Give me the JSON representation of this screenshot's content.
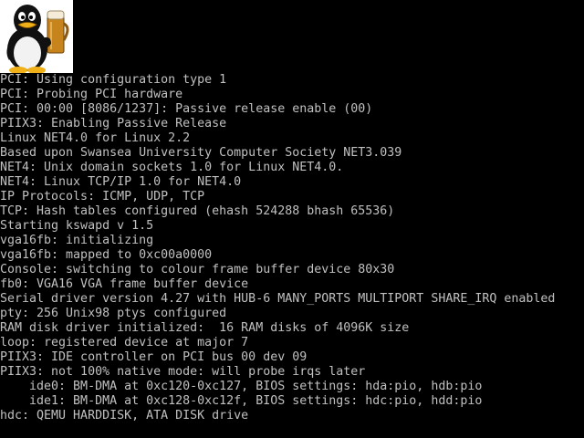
{
  "screen": {
    "background": "#000000",
    "text_color": "#c0c0c0"
  },
  "logo": {
    "icon": "tux-penguin-with-beer-icon"
  },
  "console": {
    "lines": [
      "PCI: Using configuration type 1",
      "PCI: Probing PCI hardware",
      "PCI: 00:00 [8086/1237]: Passive release enable (00)",
      "PIIX3: Enabling Passive Release",
      "Linux NET4.0 for Linux 2.2",
      "Based upon Swansea University Computer Society NET3.039",
      "NET4: Unix domain sockets 1.0 for Linux NET4.0.",
      "NET4: Linux TCP/IP 1.0 for NET4.0",
      "IP Protocols: ICMP, UDP, TCP",
      "TCP: Hash tables configured (ehash 524288 bhash 65536)",
      "Starting kswapd v 1.5",
      "vga16fb: initializing",
      "vga16fb: mapped to 0xc00a0000",
      "Console: switching to colour frame buffer device 80x30",
      "fb0: VGA16 VGA frame buffer device",
      "Serial driver version 4.27 with HUB-6 MANY_PORTS MULTIPORT SHARE_IRQ enabled",
      "pty: 256 Unix98 ptys configured",
      "RAM disk driver initialized:  16 RAM disks of 4096K size",
      "loop: registered device at major 7",
      "PIIX3: IDE controller on PCI bus 00 dev 09",
      "PIIX3: not 100% native mode: will probe irqs later",
      "    ide0: BM-DMA at 0xc120-0xc127, BIOS settings: hda:pio, hdb:pio",
      "    ide1: BM-DMA at 0xc128-0xc12f, BIOS settings: hdc:pio, hdd:pio",
      "hdc: QEMU HARDDISK, ATA DISK drive"
    ]
  }
}
